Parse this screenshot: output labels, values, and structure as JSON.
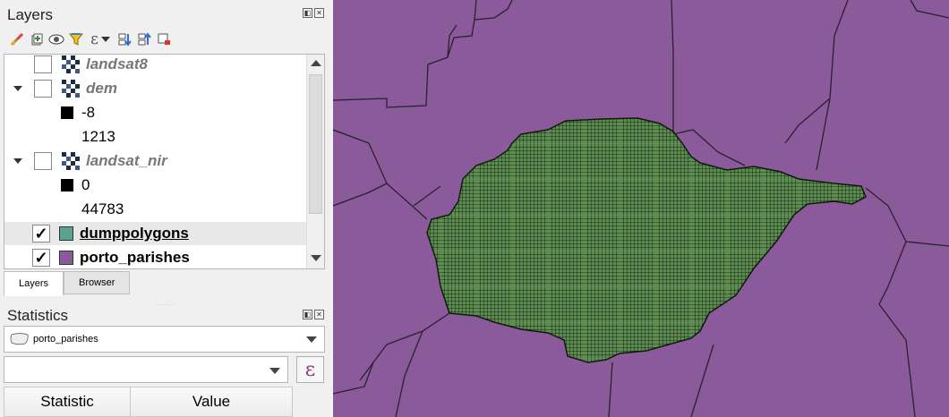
{
  "layers_panel": {
    "title": "Layers",
    "dock_float_glyph": "◧",
    "dock_close_glyph": "✕",
    "toolbar_icons": [
      "style-manager-icon",
      "add-group-icon",
      "visibility-icon",
      "filter-icon",
      "expression-filter-icon",
      "expand-all-icon",
      "collapse-all-icon",
      "remove-layer-icon"
    ],
    "expression_glyph": "ε",
    "tree": [
      {
        "kind": "raster",
        "name": "landsat8",
        "checked": false,
        "expanded": false
      },
      {
        "kind": "raster",
        "name": "dem",
        "checked": false,
        "expanded": true
      },
      {
        "kind": "legend-black",
        "value": "-8"
      },
      {
        "kind": "legend-text",
        "value": "1213"
      },
      {
        "kind": "raster",
        "name": "landsat_nir",
        "checked": false,
        "expanded": true
      },
      {
        "kind": "legend-black",
        "value": "0"
      },
      {
        "kind": "legend-text",
        "value": "44783"
      },
      {
        "kind": "vector",
        "name": "dumppolygons",
        "checked": true,
        "color": "#5aa392"
      },
      {
        "kind": "vector",
        "name": "porto_parishes",
        "checked": true,
        "color": "#8a5a9a"
      }
    ],
    "check_glyph": "✓"
  },
  "dock_tabs": [
    {
      "label": "Layers",
      "active": true
    },
    {
      "label": "Browser",
      "active": false
    }
  ],
  "statistics_panel": {
    "title": "Statistics",
    "layer_select_value": "porto_parishes",
    "field_select_value": "",
    "expression_button_glyph": "ε",
    "table_headers": [
      "Statistic",
      "Value"
    ]
  },
  "colors": {
    "parish_fill": "#8a5a9a",
    "grid_fill": "#5c8d4e",
    "grid_line": "#1a2a18",
    "boundary": "#2b2030"
  }
}
